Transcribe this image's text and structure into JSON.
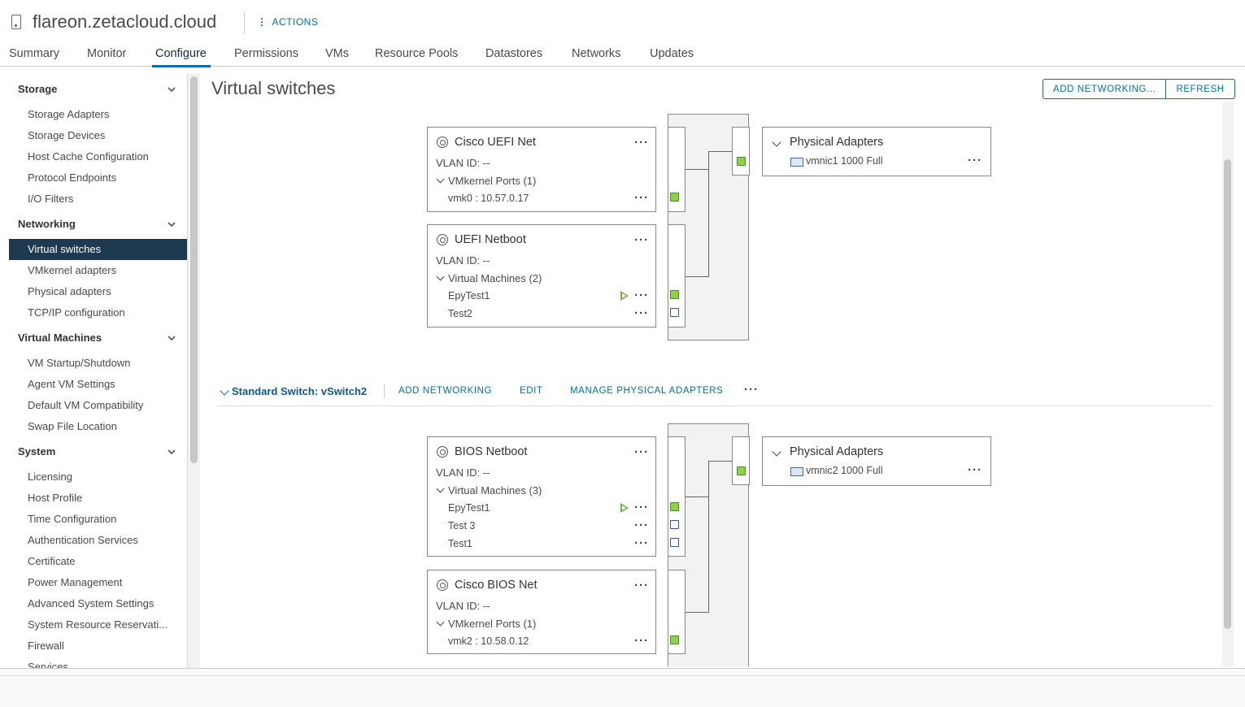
{
  "header": {
    "host_title": "flareon.zetacloud.cloud",
    "actions_label": "ACTIONS",
    "tabs": [
      "Summary",
      "Monitor",
      "Configure",
      "Permissions",
      "VMs",
      "Resource Pools",
      "Datastores",
      "Networks",
      "Updates"
    ],
    "active_tab": "Configure"
  },
  "sidebar": {
    "groups": [
      {
        "label": "Storage",
        "items": [
          "Storage Adapters",
          "Storage Devices",
          "Host Cache Configuration",
          "Protocol Endpoints",
          "I/O Filters"
        ]
      },
      {
        "label": "Networking",
        "items": [
          "Virtual switches",
          "VMkernel adapters",
          "Physical adapters",
          "TCP/IP configuration"
        ]
      },
      {
        "label": "Virtual Machines",
        "items": [
          "VM Startup/Shutdown",
          "Agent VM Settings",
          "Default VM Compatibility",
          "Swap File Location"
        ]
      },
      {
        "label": "System",
        "items": [
          "Licensing",
          "Host Profile",
          "Time Configuration",
          "Authentication Services",
          "Certificate",
          "Power Management",
          "Advanced System Settings",
          "System Resource Reservati...",
          "Firewall",
          "Services"
        ]
      }
    ],
    "active_item": "Virtual switches"
  },
  "main": {
    "title": "Virtual switches",
    "add_networking_button": "ADD NETWORKING...",
    "refresh_button": "REFRESH"
  },
  "switch1": {
    "port_groups": [
      {
        "name": "Cisco UEFI Net",
        "vlan": "VLAN ID: --",
        "section": "VMkernel Ports (1)",
        "rows": [
          {
            "label": "vmk0 : 10.57.0.17"
          }
        ]
      },
      {
        "name": "UEFI Netboot",
        "vlan": "VLAN ID: --",
        "section": "Virtual Machines (2)",
        "rows": [
          {
            "label": "EpyTest1",
            "powered_on": true
          },
          {
            "label": "Test2",
            "powered_on": false
          }
        ]
      }
    ],
    "physical_adapters": {
      "title": "Physical Adapters",
      "nic": "vmnic1 1000 Full"
    }
  },
  "switch2": {
    "name": "Standard Switch: vSwitch2",
    "add_networking_link": "ADD NETWORKING",
    "edit_link": "EDIT",
    "manage_link": "MANAGE PHYSICAL ADAPTERS",
    "port_groups": [
      {
        "name": "BIOS Netboot",
        "vlan": "VLAN ID: --",
        "section": "Virtual Machines (3)",
        "rows": [
          {
            "label": "EpyTest1",
            "powered_on": true
          },
          {
            "label": "Test 3",
            "powered_on": false
          },
          {
            "label": "Test1",
            "powered_on": false
          }
        ]
      },
      {
        "name": "Cisco BIOS Net",
        "vlan": "VLAN ID: --",
        "section": "VMkernel Ports (1)",
        "rows": [
          {
            "label": "vmk2 : 10.58.0.12"
          }
        ]
      }
    ],
    "physical_adapters": {
      "title": "Physical Adapters",
      "nic": "vmnic2 1000 Full"
    }
  },
  "icons": {
    "more": "more-horizontal-icon",
    "port_group": "network-globe-icon",
    "nic": "network-adapter-icon",
    "power_on": "play-icon"
  },
  "colors": {
    "accent": "#0072a3",
    "sidebar_active": "#1d3a51",
    "port_connected": "#8fd24a",
    "power_on": "#6db33f"
  }
}
